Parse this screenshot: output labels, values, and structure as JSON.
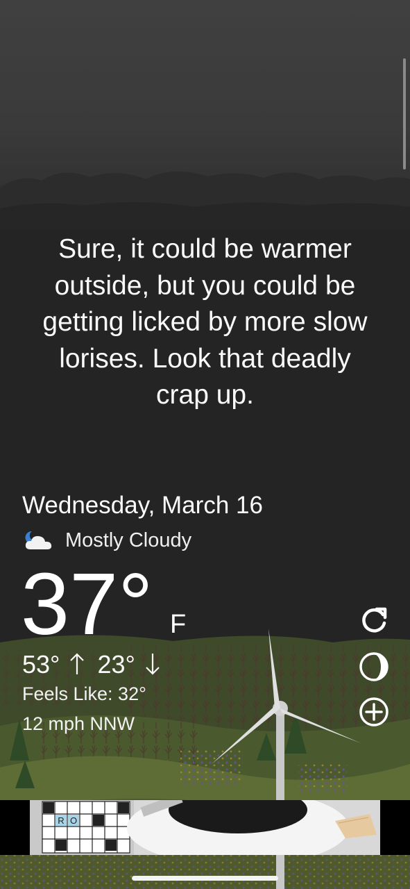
{
  "quote": {
    "line1": "Sure, it could be warmer",
    "line2": "outside, but you could be",
    "line3": "getting licked by more slow",
    "line4": "lorises. Look that deadly",
    "line5": "crap up."
  },
  "weather": {
    "date": "Wednesday, March 16",
    "condition": "Mostly Cloudy",
    "condition_icon": "partly-cloudy-night-icon",
    "temperature": "37°",
    "unit": "F",
    "high": "53°",
    "low": "23°",
    "feels_like": "Feels Like: 32°",
    "wind": "12 mph NNW"
  },
  "actions": [
    {
      "icon": "refresh-icon"
    },
    {
      "icon": "moon-phase-icon"
    },
    {
      "icon": "add-icon"
    }
  ],
  "ad": {
    "crossword_letters": [
      "R",
      "O"
    ],
    "icon": "crossword-ad-image"
  },
  "colors": {
    "background": "#242424",
    "text": "#ffffff",
    "hill_dark": "#3a4a2a",
    "hill_light": "#5b6a38"
  }
}
